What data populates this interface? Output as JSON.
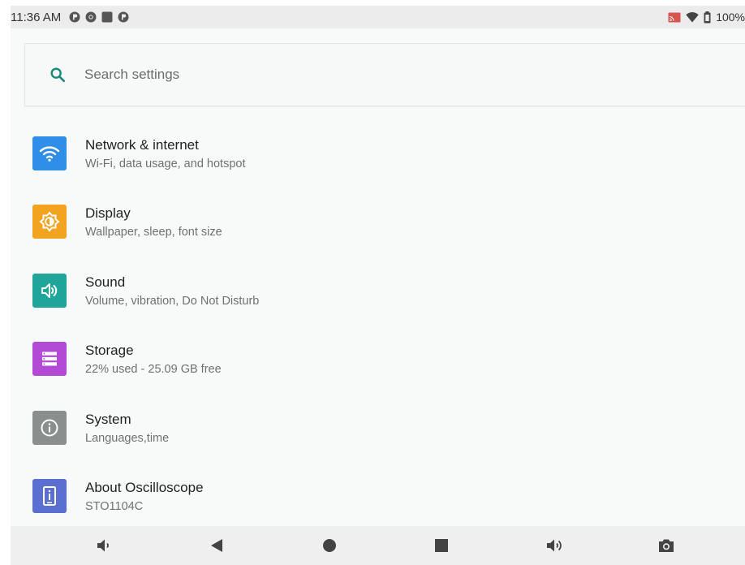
{
  "status_bar": {
    "time": "11:36 AM",
    "notification_icons": [
      "app-notification-icon",
      "chrome-icon",
      "square-notification-icon",
      "app-notification-icon"
    ],
    "battery_text": "100%",
    "right_icons": [
      "cast-icon",
      "wifi-icon",
      "battery-icon"
    ]
  },
  "search": {
    "placeholder": "Search settings",
    "accent": "#1a8a7a"
  },
  "items": [
    {
      "title": "Network & internet",
      "subtitle": "Wi-Fi, data usage, and hotspot",
      "icon": "wifi-icon",
      "color": "#2f8ee8"
    },
    {
      "title": "Display",
      "subtitle": "Wallpaper, sleep, font size",
      "icon": "brightness-icon",
      "color": "#f2a420"
    },
    {
      "title": "Sound",
      "subtitle": "Volume, vibration, Do Not Disturb",
      "icon": "volume-icon",
      "color": "#1fa59a"
    },
    {
      "title": "Storage",
      "subtitle": "22% used - 25.09 GB free",
      "icon": "storage-icon",
      "color": "#b24ad6"
    },
    {
      "title": "System",
      "subtitle": "Languages,time",
      "icon": "info-icon",
      "color": "#8a8f8d"
    },
    {
      "title": "About Oscilloscope",
      "subtitle": "STO1104C",
      "icon": "device-icon",
      "color": "#5a6fd0"
    }
  ],
  "nav_bar": [
    "volume-down-icon",
    "back-icon",
    "home-icon",
    "recents-icon",
    "volume-up-icon",
    "screenshot-icon"
  ]
}
